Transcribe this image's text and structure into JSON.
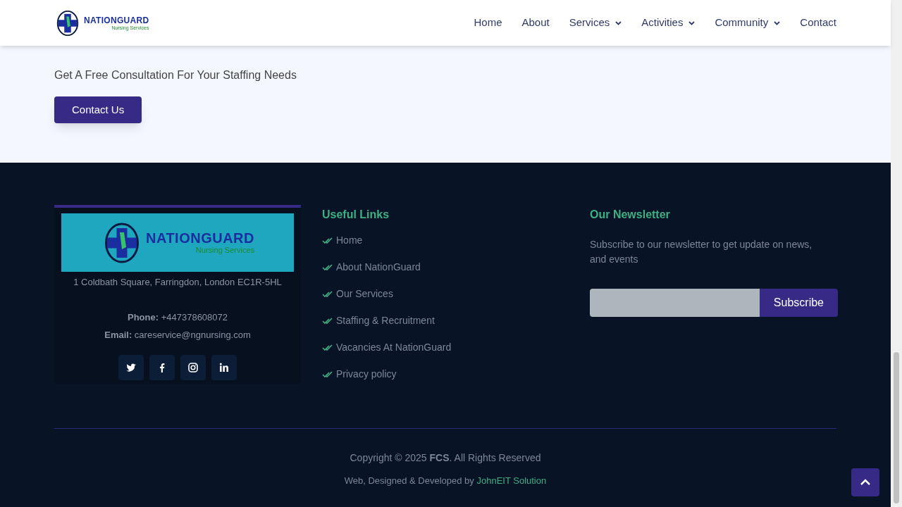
{
  "header": {
    "logo": {
      "wordmark": "NATIONGUARD",
      "tagline": "Nursing Services"
    },
    "nav": [
      {
        "label": "Home",
        "has_dropdown": false
      },
      {
        "label": "About",
        "has_dropdown": false
      },
      {
        "label": "Services",
        "has_dropdown": true
      },
      {
        "label": "Activities",
        "has_dropdown": true
      },
      {
        "label": "Community",
        "has_dropdown": true
      },
      {
        "label": "Contact",
        "has_dropdown": false
      }
    ]
  },
  "cta": {
    "text": "Get A Free Consultation For Your Staffing Needs",
    "button": "Contact Us"
  },
  "footer": {
    "about": {
      "logo": {
        "wordmark": "NATIONGUARD",
        "tagline": "Nursing Services"
      },
      "address": "1 Coldbath Square, Farringdon, London EC1R-5HL",
      "phone": "**Phone:** +447378608072",
      "email": "**Email:** careservice@ngnursing.com",
      "social": [
        {
          "kind": "twitter"
        },
        {
          "kind": "facebook"
        },
        {
          "kind": "instagram"
        },
        {
          "kind": "linkedin"
        }
      ]
    },
    "links": {
      "title": "Useful Links",
      "items": [
        "Home",
        "About NationGuard",
        "Our Services",
        "Staffing & Recruitment",
        "Vacancies At NationGuard",
        "Privacy policy"
      ]
    },
    "newsletter": {
      "title": "Our Newsletter",
      "text": "Subscribe to our newsletter to get update on news, and events",
      "button": "Subscribe"
    },
    "copyright": "Copyright © 2025 **FCS**. All Rights Reserved",
    "credit": {
      "text": "Web, Designed & Developed by",
      "link": "JohnEIT Solution"
    }
  }
}
